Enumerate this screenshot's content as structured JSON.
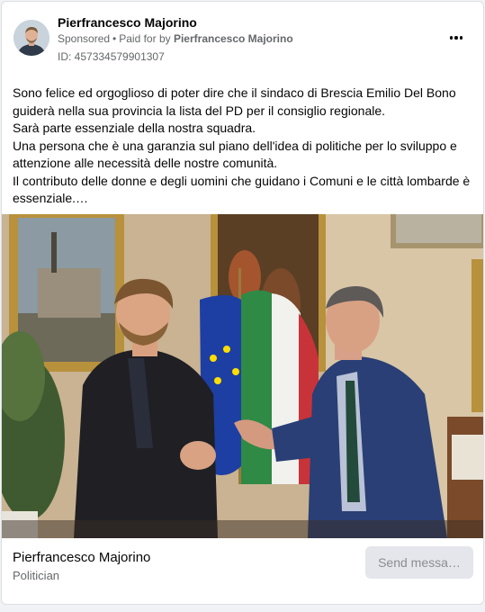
{
  "post": {
    "page_name": "Pierfrancesco Majorino",
    "sponsored": "Sponsored",
    "separator": "•",
    "paid_for_prefix": "Paid for by",
    "paid_for_name": "Pierfrancesco Majorino",
    "ad_id": "ID: 457334579901307",
    "menu_icon": "more-horizontal-icon"
  },
  "body": {
    "lines": [
      "Sono felice ed orgoglioso di poter dire che il sindaco di Brescia Emilio Del Bono guiderà nella sua provincia la lista del PD per il consiglio regionale.",
      "Sarà parte essenziale della nostra squadra.",
      "Una persona che è una garanzia sul piano dell'idea di politiche per lo sviluppo e attenzione alle necessità delle nostre comunità.",
      "Il contributo delle donne e degli uomini che guidano i Comuni e le città lombarde è essenziale.…"
    ]
  },
  "footer": {
    "name": "Pierfrancesco Majorino",
    "category": "Politician",
    "cta_label": "Send messa…"
  },
  "colors": {
    "secondary_text": "#65676b",
    "button_bg": "#e4e6eb",
    "button_text": "#8a8d91"
  }
}
